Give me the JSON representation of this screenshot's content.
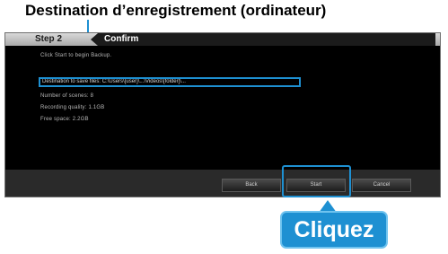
{
  "annotation": {
    "caption": "Destination d’enregistrement (ordinateur)",
    "callout": "Cliquez"
  },
  "window": {
    "step_label": "Step 2",
    "confirm_label": "Confirm",
    "lines": {
      "intro": "Click Start to begin Backup.",
      "destination": "Destination to save files: C:\\Users\\[user]\\...\\Videos\\[folder]\\..."
    },
    "details": [
      "Number of scenes: 8",
      "Recording quality: 1.1GB",
      "Free space: 2.2GB"
    ],
    "buttons": {
      "back": "Back",
      "start": "Start",
      "cancel": "Cancel"
    }
  },
  "colors": {
    "accent_blue": "#1e90d2",
    "window_bg": "#000000"
  }
}
